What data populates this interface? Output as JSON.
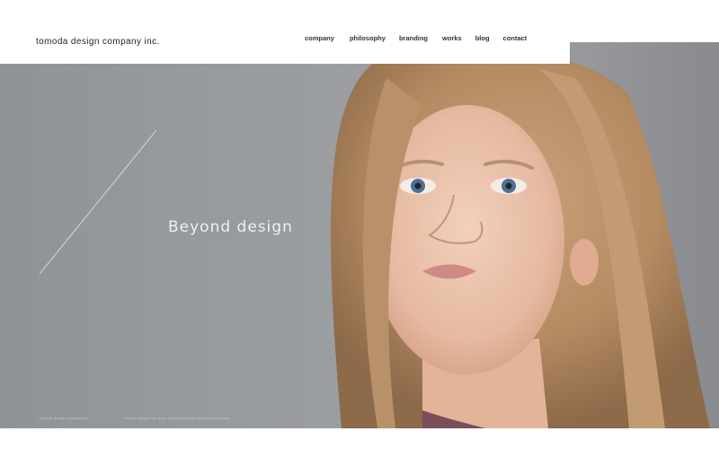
{
  "brand": {
    "logo_text": "tomoda design company inc."
  },
  "nav": {
    "items": [
      {
        "label": "company"
      },
      {
        "label": "philosophy"
      },
      {
        "label": "branding"
      },
      {
        "label": "works"
      },
      {
        "label": "blog"
      },
      {
        "label": "contact"
      }
    ]
  },
  "hero": {
    "tagline": "Beyond design",
    "photo_description_icon": "portrait-photo",
    "background_color": "#9a9da1",
    "tagline_color": "#eef0f2"
  },
  "footer": {
    "copyright": "tomoda design company inc.",
    "note": "Tomoda design has been certified by the Japan brand design."
  }
}
